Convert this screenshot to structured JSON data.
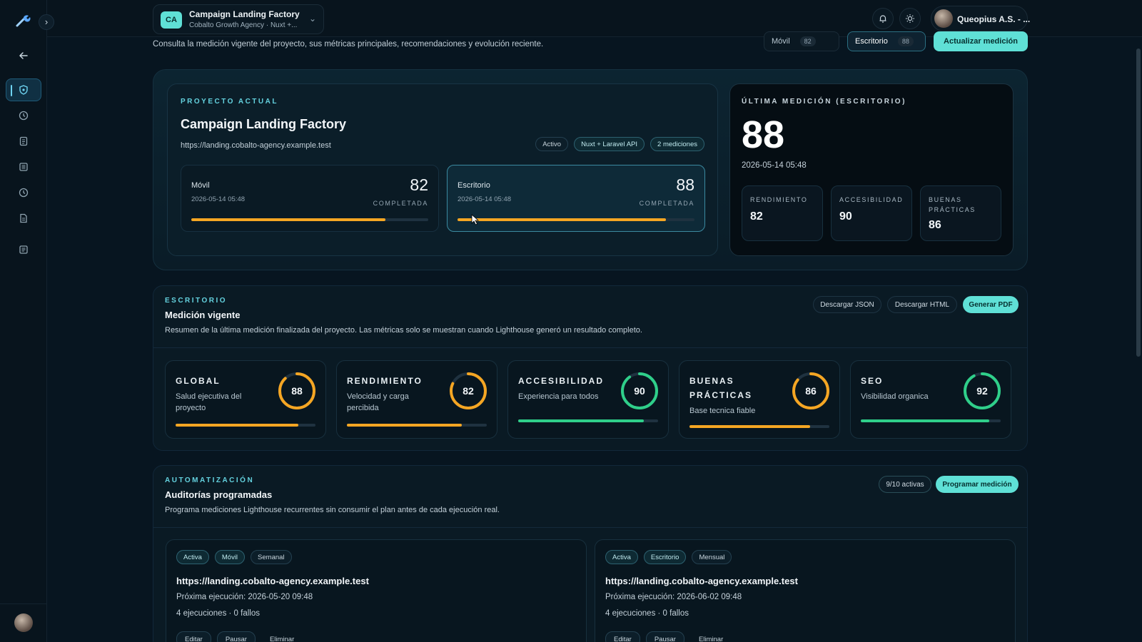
{
  "sidebar": {
    "logo_icon": "wrench-tool-icon",
    "items": [
      {
        "name": "back",
        "icon": "arrow-left-icon"
      },
      {
        "name": "overview",
        "icon": "shield-icon",
        "active": true
      },
      {
        "name": "history",
        "icon": "clock-icon"
      },
      {
        "name": "reports",
        "icon": "document-icon"
      },
      {
        "name": "list",
        "icon": "list-icon"
      },
      {
        "name": "schedule",
        "icon": "clock-icon"
      },
      {
        "name": "files",
        "icon": "file-icon"
      },
      {
        "name": "logs",
        "icon": "list-icon"
      }
    ]
  },
  "topbar": {
    "project_badge": "CA",
    "project_name": "Campaign Landing Factory",
    "project_sub": "Cobalto Growth Agency · Nuxt +...",
    "user_name": "Queopius A.S. - ..."
  },
  "subheader": {
    "description": "Consulta la medición vigente del proyecto, sus métricas principales, recomendaciones y evolución reciente.",
    "tabs": [
      {
        "label": "Móvil",
        "count": "82"
      },
      {
        "label": "Escritorio",
        "count": "88"
      }
    ],
    "update_button": "Actualizar medición"
  },
  "current_project": {
    "eyebrow": "PROYECTO ACTUAL",
    "title": "Campaign Landing Factory",
    "url": "https://landing.cobalto-agency.example.test",
    "tags": [
      "Activo",
      "Nuxt + Laravel API",
      "2 mediciones"
    ],
    "devices": [
      {
        "name": "Móvil",
        "date": "2026-05-14 05:48",
        "score": "82",
        "status": "COMPLETADA",
        "fill": 0.82
      },
      {
        "name": "Escritorio",
        "date": "2026-05-14 05:48",
        "score": "88",
        "status": "COMPLETADA",
        "fill": 0.88
      }
    ]
  },
  "last_measurement": {
    "eyebrow": "ÚLTIMA MEDICIÓN (ESCRITORIO)",
    "score": "88",
    "date": "2026-05-14 05:48",
    "metrics": [
      {
        "label": "RENDIMIENTO",
        "value": "82"
      },
      {
        "label": "ACCESIBILIDAD",
        "value": "90"
      },
      {
        "label": "BUENAS PRÁCTICAS",
        "value": "86"
      }
    ]
  },
  "desktop_section": {
    "eyebrow": "ESCRITORIO",
    "title": "Medición vigente",
    "description": "Resumen de la última medición finalizada del proyecto. Las métricas solo se muestran cuando Lighthouse generó un resultado completo.",
    "buttons": [
      "Descargar JSON",
      "Descargar HTML",
      "Generar PDF"
    ],
    "metrics": [
      {
        "title": "GLOBAL",
        "sub": "Salud ejecutiva del proyecto",
        "score": 88,
        "color": "#f5a623"
      },
      {
        "title": "RENDIMIENTO",
        "sub": "Velocidad y carga percibida",
        "score": 82,
        "color": "#f5a623"
      },
      {
        "title": "ACCESIBILIDAD",
        "sub": "Experiencia para todos",
        "score": 90,
        "color": "#2fcf8a"
      },
      {
        "title": "BUENAS PRÁCTICAS",
        "sub": "Base tecnica fiable",
        "score": 86,
        "color": "#f5a623"
      },
      {
        "title": "SEO",
        "sub": "Visibilidad organica",
        "score": 92,
        "color": "#2fcf8a"
      }
    ]
  },
  "automation": {
    "eyebrow": "AUTOMATIZACIÓN",
    "title": "Auditorías programadas",
    "description": "Programa mediciones Lighthouse recurrentes sin consumir el plan antes de cada ejecución real.",
    "active_count": "9/10 activas",
    "schedule_button": "Programar medición",
    "schedules": [
      {
        "tags": [
          "Activa",
          "Móvil",
          "Semanal"
        ],
        "url": "https://landing.cobalto-agency.example.test",
        "next": "Próxima ejecución: 2026-05-20 09:48",
        "runs": "4 ejecuciones · 0 fallos",
        "actions": [
          "Editar",
          "Pausar",
          "Eliminar"
        ]
      },
      {
        "tags": [
          "Activa",
          "Escritorio",
          "Mensual"
        ],
        "url": "https://landing.cobalto-agency.example.test",
        "next": "Próxima ejecución: 2026-06-02 09:48",
        "runs": "4 ejecuciones · 0 fallos",
        "actions": [
          "Editar",
          "Pausar",
          "Eliminar"
        ]
      }
    ]
  },
  "colors": {
    "accent": "#5fe0d6",
    "warning": "#f5a623",
    "good": "#2fcf8a"
  }
}
